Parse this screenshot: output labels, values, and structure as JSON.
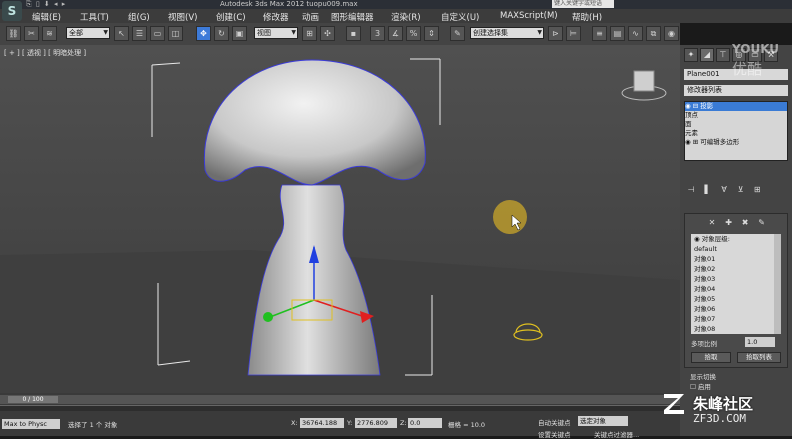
{
  "window": {
    "title": "Autodesk 3ds Max  2012    tuopu009.max",
    "search_placeholder": "键入关键字或短语",
    "logo": "S"
  },
  "menu": [
    "编辑(E)",
    "工具(T)",
    "组(G)",
    "视图(V)",
    "创建(C)",
    "修改器",
    "动画",
    "图形编辑器",
    "渲染(R)",
    "自定义(U)",
    "MAXScript(M)",
    "帮助(H)"
  ],
  "toolbar": {
    "selection_filter": "全部",
    "reference_coord": "视图",
    "named_selection": "创建选择集"
  },
  "viewport": {
    "label": "[ + ] [ 透视 ] [ 明暗处理 ]"
  },
  "right_panel": {
    "object_name": "Plane001",
    "modifier_list": "修改器列表",
    "stack": [
      {
        "label": "◉ ⊟ 投影",
        "selected": true
      },
      {
        "label": "      顶点",
        "selected": false
      },
      {
        "label": "      面",
        "selected": false
      },
      {
        "label": "      元素",
        "selected": false
      },
      {
        "label": "◉ ⊞ 可编辑多边形",
        "selected": false
      }
    ],
    "object_level_header": "◉ 对象层级:",
    "object_levels": [
      "default",
      "对象01",
      "对象02",
      "对象03",
      "对象04",
      "对象05",
      "对象06",
      "对象07",
      "对象08"
    ],
    "multi_ratio_label": "多项比例",
    "multi_ratio_value": "1.0",
    "pick_button": "拾取",
    "pick_list_button": "拾取列表",
    "display_switch": "显示切换",
    "enable_label": "启用"
  },
  "timeline": {
    "frame": "0 / 100",
    "ticks": [
      "0",
      "5",
      "10",
      "15",
      "20",
      "25",
      "30",
      "35",
      "40",
      "45",
      "50",
      "55",
      "60",
      "65",
      "70",
      "75",
      "80",
      "85",
      "90",
      "95",
      "100"
    ]
  },
  "status": {
    "script_field": "Max to Physc",
    "message": "选择了 1 个 对象",
    "x_label": "X:",
    "x_value": "36764.188",
    "y_label": "Y:",
    "y_value": "2776.809",
    "z_label": "Z:",
    "z_value": "0.0",
    "grid_label": "栅格 = 10.0",
    "auto_key": "自动关键点",
    "selected_obj": "选定对象",
    "set_key": "设置关键点",
    "key_filter": "关键点过滤器..."
  },
  "watermark": {
    "youku_en": "YOUKU",
    "youku_cn": "优酷",
    "brand_cn": "朱峰社区",
    "brand_url": "ZF3D.COM"
  },
  "colors": {
    "selected_blue": "#3a7bd5",
    "viewport_bg": "#4a4a4a",
    "gizmo_red": "#e02020",
    "gizmo_green": "#20c020",
    "gizmo_blue": "#2040e0",
    "gizmo_yellow": "#e0c020"
  }
}
